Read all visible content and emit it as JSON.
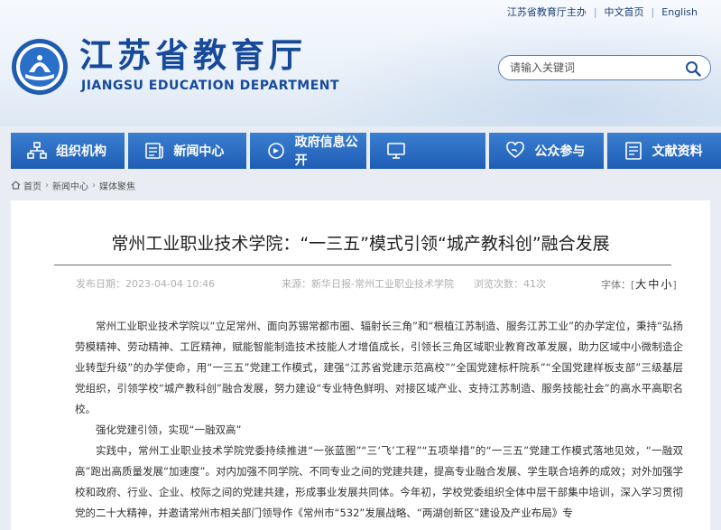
{
  "topbar": {
    "sponsor": "江苏省教育厅主办",
    "chinese": "中文首页",
    "english": "English"
  },
  "brand": {
    "name_cn": "江苏省教育厅",
    "name_en": "JIANGSU EDUCATION DEPARTMENT"
  },
  "search": {
    "placeholder": "请输入关键词"
  },
  "nav": [
    {
      "label": "组织机构",
      "icon": "org-chart-icon"
    },
    {
      "label": "新闻中心",
      "icon": "news-icon"
    },
    {
      "label": "政府信息公开",
      "icon": "info-icon"
    },
    {
      "label": "",
      "icon": "computer-icon"
    },
    {
      "label": "公众参与",
      "icon": "heart-hands-icon"
    },
    {
      "label": "文献资料",
      "icon": "document-icon"
    }
  ],
  "breadcrumb": [
    "首页",
    "新闻中心",
    "媒体聚焦"
  ],
  "article": {
    "title": "常州工业职业技术学院：“一三五”模式引领“城产教科创”融合发展",
    "meta": {
      "date": "发布日期：2023-04-04 10:46",
      "source": "来源：新华日报-常州工业职业技术学院",
      "views": "浏览次数：41次",
      "fontsize_label": "字体：",
      "big": "大",
      "mid": "中",
      "small": "小"
    },
    "paragraphs": [
      "常州工业职业技术学院以“立足常州、面向苏锡常都市圈、辐射长三角”和“根植江苏制造、服务江苏工业”的办学定位，秉持“弘扬劳模精神、劳动精神、工匠精神，赋能智能制造技术技能人才增值成长，引领长三角区域职业教育改革发展，助力区域中小微制造企业转型升级”的办学使命，用“一三五”党建工作模式，建强“江苏省党建示范高校”“全国党建标杆院系”“全国党建样板支部”三级基层党组织，引领学校“城产教科创”融合发展，努力建设“专业特色鲜明、对接区域产业、支持江苏制造、服务技能社会”的高水平高职名校。",
      "强化党建引领，实现“一融双高”",
      "实践中，常州工业职业技术学院党委持续推进“一张蓝图”“三‘飞’工程”“五项举措”的“一三五”党建工作模式落地见效，“一融双高”跑出高质量发展“加速度”。对内加强不同学院、不同专业之间的党建共建，提高专业融合发展、学生联合培养的成效；对外加强学校和政府、行业、企业、校际之间的党建共建，形成事业发展共同体。今年初，学校党委组织全体中层干部集中培训，深入学习贯彻党的二十大精神，并邀请常州市相关部门领导作《常州市“532”发展战略、“两湖创新区”建设及产业布局》专"
    ]
  },
  "colors": {
    "brand_blue": "#174a9b",
    "nav_blue": "#2a6cc4"
  }
}
